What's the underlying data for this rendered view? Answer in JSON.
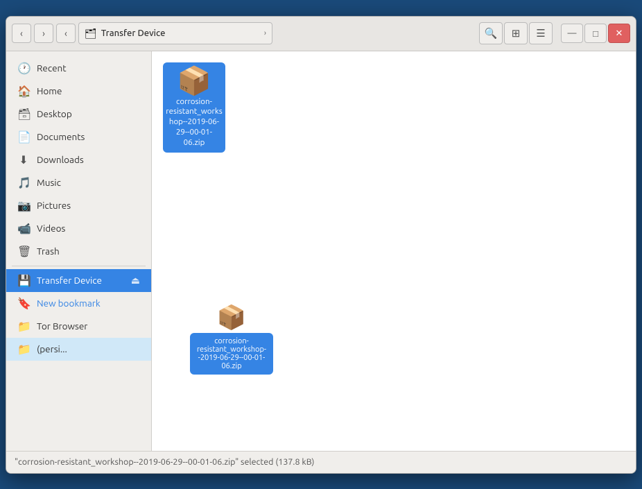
{
  "window": {
    "title": "Transfer Device"
  },
  "titlebar": {
    "back_label": "‹",
    "forward_label": "›",
    "prev_label": "‹",
    "location_icon": "🗂",
    "location_text": "Transfer Device",
    "location_arrow": "›",
    "search_icon": "🔍",
    "view_icon1": "⊞",
    "view_icon2": "☰",
    "minimize": "—",
    "maximize": "□",
    "close": "✕"
  },
  "sidebar": {
    "items": [
      {
        "id": "recent",
        "label": "Recent",
        "icon": "🕐",
        "active": false
      },
      {
        "id": "home",
        "label": "Home",
        "icon": "🏠",
        "active": false
      },
      {
        "id": "desktop",
        "label": "Desktop",
        "icon": "🗃",
        "active": false
      },
      {
        "id": "documents",
        "label": "Documents",
        "icon": "📄",
        "active": false
      },
      {
        "id": "downloads",
        "label": "Downloads",
        "icon": "⬇",
        "active": false
      },
      {
        "id": "music",
        "label": "Music",
        "icon": "🎵",
        "active": false
      },
      {
        "id": "pictures",
        "label": "Pictures",
        "icon": "📷",
        "active": false
      },
      {
        "id": "videos",
        "label": "Videos",
        "icon": "📹",
        "active": false
      },
      {
        "id": "trash",
        "label": "Trash",
        "icon": "🗑",
        "active": false
      },
      {
        "id": "transfer-device",
        "label": "Transfer Device",
        "icon": "💾",
        "active": true,
        "eject": "⏏"
      },
      {
        "id": "new-bookmark",
        "label": "New bookmark",
        "icon": "🔖",
        "active": false,
        "special": true
      },
      {
        "id": "tor-browser",
        "label": "Tor Browser",
        "icon": "📁",
        "active": false
      },
      {
        "id": "persistent",
        "label": "Persistent",
        "icon": "📁",
        "active": false
      }
    ]
  },
  "files": [
    {
      "id": "zip-file",
      "icon": "📦",
      "label": "corrosion-resistant_workshop--2019-06-29--00-01-06.zip",
      "selected": true
    }
  ],
  "statusbar": {
    "text": "\"corrosion-resistant_workshop--2019-06-29--00-01-06.zip\" selected  (137.8 kB)"
  },
  "drag_tooltip": {
    "text": "corrosion-resistant_workshop--2019-06-29--00-01-06.zip"
  }
}
